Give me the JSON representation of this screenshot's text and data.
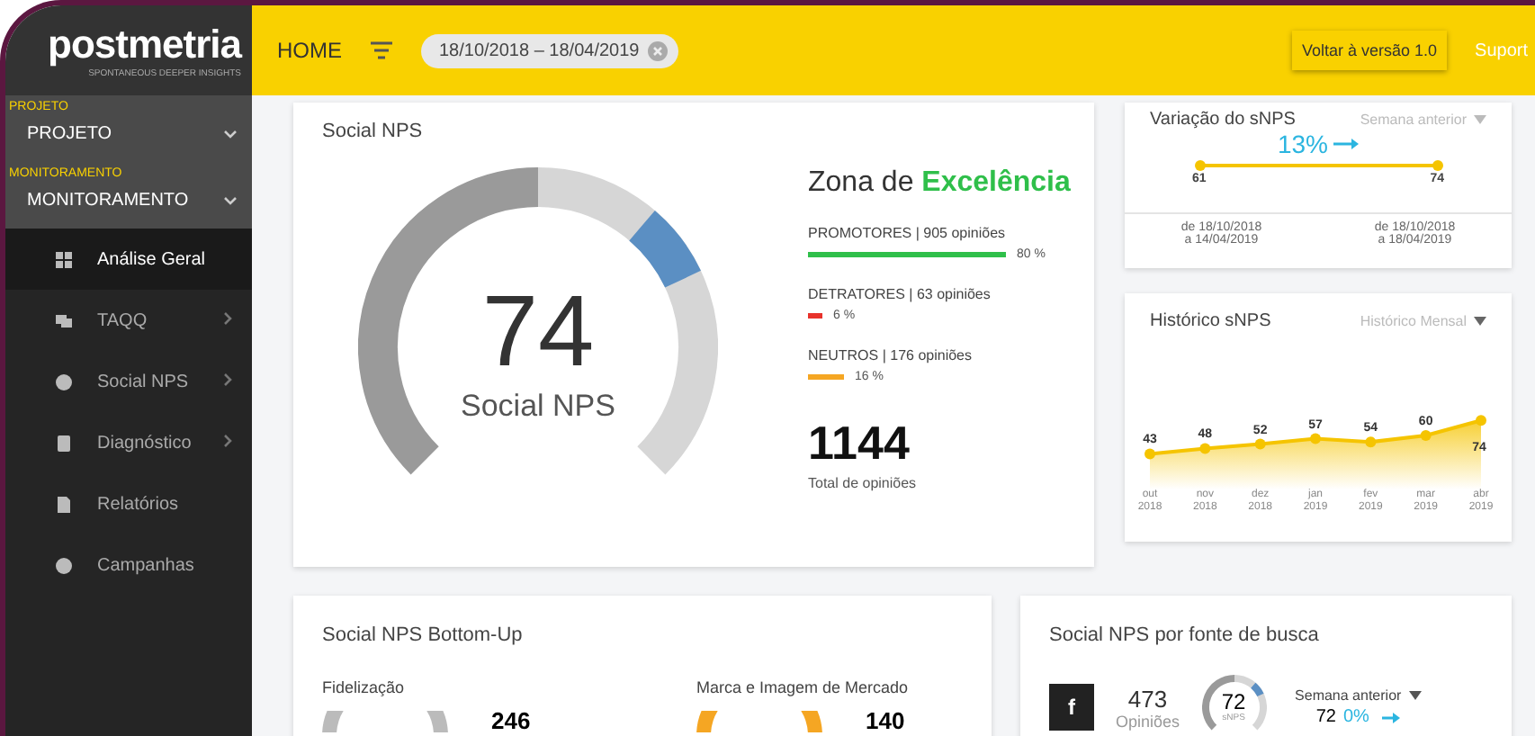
{
  "logo": {
    "name": "postmetria",
    "tagline": "SPONTANEOUS DEEPER INSIGHTS"
  },
  "topbar": {
    "home": "HOME",
    "date_range": "18/10/2018 – 18/04/2019",
    "version_button": "Voltar à versão 1.0",
    "support": "Suport"
  },
  "sidebar": {
    "sections": [
      {
        "label": "PROJETO",
        "value": "PROJETO"
      },
      {
        "label": "MONITORAMENTO",
        "value": "MONITORAMENTO"
      }
    ],
    "items": [
      {
        "label": "Análise Geral",
        "selected": true,
        "expandable": false
      },
      {
        "label": "TAQQ",
        "selected": false,
        "expandable": true
      },
      {
        "label": "Social NPS",
        "selected": false,
        "expandable": true
      },
      {
        "label": "Diagnóstico",
        "selected": false,
        "expandable": true
      },
      {
        "label": "Relatórios",
        "selected": false,
        "expandable": false
      },
      {
        "label": "Campanhas",
        "selected": false,
        "expandable": false
      }
    ]
  },
  "social_nps": {
    "title": "Social NPS",
    "score": "74",
    "score_label": "Social NPS",
    "zone_prefix": "Zona de",
    "zone": "Excelência",
    "groups": [
      {
        "label": "PROMOTORES | 905 opiniões",
        "percent": "80 %",
        "color": "#2fbf4a"
      },
      {
        "label": "DETRATORES | 63 opiniões",
        "percent": "6 %",
        "color": "#e8322b"
      },
      {
        "label": "NEUTROS | 176 opiniões",
        "percent": "16 %",
        "color": "#f5a623"
      }
    ],
    "total": "1144",
    "total_label": "Total de opiniões"
  },
  "variation": {
    "title": "Variação do sNPS",
    "period": "Semana anterior",
    "change": "13%",
    "start": "61",
    "end": "74",
    "ranges": [
      "de 18/10/2018\na 14/04/2019",
      "de 18/10/2018\na 18/04/2019"
    ]
  },
  "history": {
    "title": "Histórico sNPS",
    "period": "Histórico Mensal",
    "chart_data": {
      "type": "area",
      "categories": [
        "out\n2018",
        "nov\n2018",
        "dez\n2018",
        "jan\n2019",
        "fev\n2019",
        "mar\n2019",
        "abr\n2019"
      ],
      "series": [
        {
          "color": "#f5c400",
          "values": [
            43,
            48,
            52,
            57,
            54,
            60,
            74
          ]
        }
      ],
      "data_labels": true
    }
  },
  "bottom_up": {
    "title": "Social NPS Bottom-Up",
    "columns": [
      {
        "title": "Fidelização",
        "value": "246"
      },
      {
        "title": "Marca e Imagem de Mercado",
        "value": "140"
      }
    ]
  },
  "by_source": {
    "title": "Social NPS por fonte de busca",
    "rows": [
      {
        "source": "f",
        "count": "473",
        "count_label": "Opiniões",
        "score": "72",
        "score_label": "sNPS",
        "period": "Semana anterior",
        "previous": "72",
        "change": "0%"
      }
    ]
  }
}
